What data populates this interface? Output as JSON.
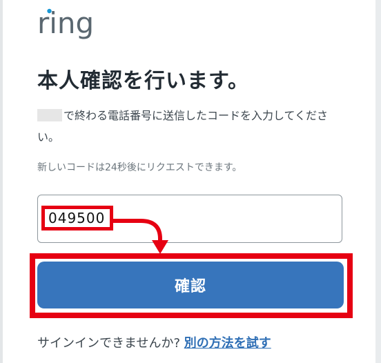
{
  "brand": {
    "logo_text": "ring",
    "logo_color": "#5a6770",
    "logo_dot_color": "#1998d5"
  },
  "header": {
    "title": "本人確認を行います。"
  },
  "main": {
    "description": "で終わる電話番号に送信したコードを入力してください。",
    "resend_notice": "新しいコードは24秒後にリクエストできます。",
    "code_input": {
      "value": "049500",
      "placeholder": ""
    },
    "confirm_label": "確認"
  },
  "footer": {
    "prompt": "サインインできませんか?",
    "link_label": "別の方法を試す"
  },
  "colors": {
    "primary_button": "#3775bc",
    "highlight_red": "#e60012",
    "link": "#2f6fb5"
  }
}
